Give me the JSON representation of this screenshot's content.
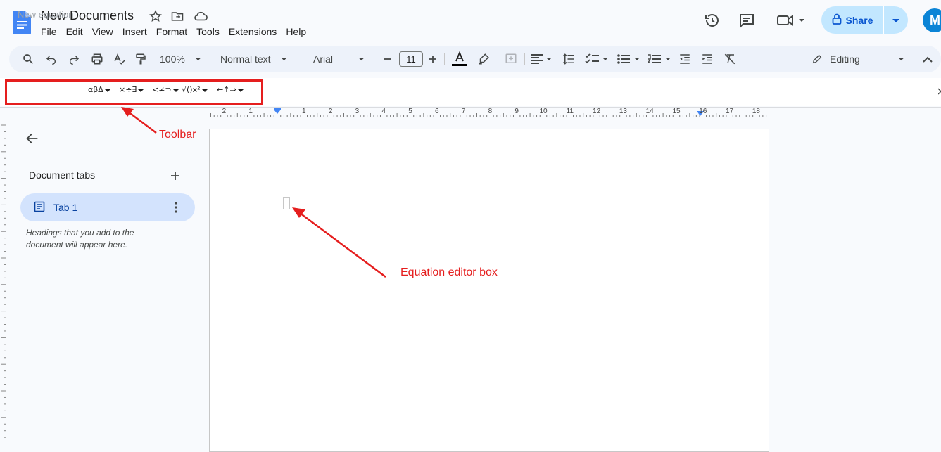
{
  "header": {
    "doc_title": "New Documents",
    "menu": [
      "File",
      "Edit",
      "View",
      "Insert",
      "Format",
      "Tools",
      "Extensions",
      "Help"
    ],
    "share_label": "Share",
    "avatar_letter": "M"
  },
  "toolbar": {
    "zoom": "100%",
    "style": "Normal text",
    "font": "Arial",
    "font_size": "11",
    "mode": "Editing"
  },
  "equation_toolbar": {
    "placeholder": "New equation",
    "groups": [
      "αβΔ",
      "×÷∃",
      "<≠⊃",
      "√()x²",
      "←↑⇒"
    ]
  },
  "ruler": {
    "labels": [
      "2",
      "1",
      "1",
      "2",
      "3",
      "4",
      "5",
      "6",
      "7",
      "8",
      "9",
      "10",
      "11",
      "12",
      "13",
      "14",
      "15",
      "16",
      "17",
      "18"
    ]
  },
  "sidebar": {
    "tabs_heading": "Document tabs",
    "tab1_label": "Tab 1",
    "hint": "Headings that you add to the document will appear here."
  },
  "annotations": {
    "toolbar": "Toolbar",
    "equation_box": "Equation editor box",
    "color": "#e51e1e"
  },
  "colors": {
    "accent": "#0b57d0",
    "share_bg": "#c2e7ff",
    "tab_active_bg": "#d3e3fd"
  }
}
